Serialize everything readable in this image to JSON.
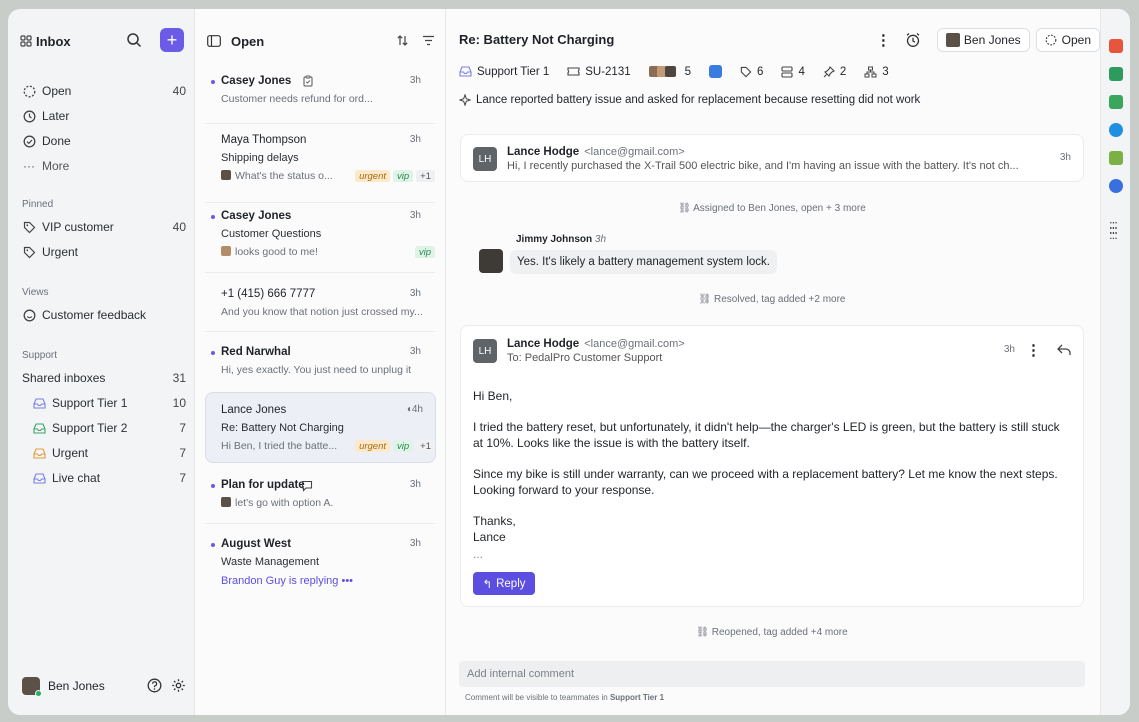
{
  "sidebar": {
    "title": "Inbox",
    "nav": [
      {
        "label": "Open",
        "count": "40"
      },
      {
        "label": "Later",
        "count": ""
      },
      {
        "label": "Done",
        "count": ""
      },
      {
        "label": "More",
        "count": ""
      }
    ],
    "pinned_label": "Pinned",
    "pinned": [
      {
        "label": "VIP customer",
        "count": "40"
      },
      {
        "label": "Urgent",
        "count": ""
      }
    ],
    "views_label": "Views",
    "views": [
      {
        "label": "Customer feedback"
      }
    ],
    "support_label": "Support",
    "shared_inboxes": {
      "label": "Shared inboxes",
      "count": "31"
    },
    "inboxes": [
      {
        "label": "Support Tier 1",
        "count": "10"
      },
      {
        "label": "Support Tier 2",
        "count": "7"
      },
      {
        "label": "Urgent",
        "count": "7"
      },
      {
        "label": "Live chat",
        "count": "7"
      }
    ],
    "user": "Ben Jones"
  },
  "list": {
    "title": "Open",
    "items": [
      {
        "name": "Casey Jones",
        "time": "3h",
        "subject": "",
        "preview": "Customer needs refund for ord..."
      },
      {
        "name": "Maya Thompson",
        "time": "3h",
        "subject": "Shipping delays",
        "preview": "What's the status o...",
        "tags": [
          "urgent",
          "vip",
          "+1"
        ]
      },
      {
        "name": "Casey Jones",
        "time": "3h",
        "subject": "Customer Questions",
        "preview": "looks good to me!",
        "tags": [
          "vip"
        ]
      },
      {
        "name": "+1 (415) 666 7777",
        "time": "3h",
        "subject": "",
        "preview": "And you know that notion just crossed my..."
      },
      {
        "name": "Red Narwhal",
        "time": "3h",
        "subject": "",
        "preview": "Hi, yes exactly. You just need to unplug it"
      },
      {
        "name": "Lance Jones",
        "time": "4h",
        "subject": "Re: Battery Not Charging",
        "preview": "Hi Ben, I tried the batte...",
        "tags": [
          "urgent",
          "vip",
          "+1"
        ]
      },
      {
        "name": "Plan for update",
        "time": "3h",
        "subject": "",
        "preview": "let's go with option A."
      },
      {
        "name": "August West",
        "time": "3h",
        "subject": "Waste Management",
        "preview": "Brandon Guy is replying"
      }
    ]
  },
  "conversation": {
    "title": "Re: Battery Not Charging",
    "assignee": "Ben Jones",
    "status": "Open",
    "meta": {
      "inbox": "Support Tier 1",
      "ticket": "SU-2131",
      "people": "5",
      "tags": "6",
      "stack": "4",
      "pins": "2",
      "links": "3"
    },
    "summary": "Lance reported battery issue and asked for replacement because resetting did not work",
    "msg1": {
      "initials": "LH",
      "name": "Lance Hodge",
      "email": "<lance@gmail.com>",
      "time": "3h",
      "preview": "Hi, I recently purchased the X-Trail 500 electric bike, and I'm having an issue with the battery. It's not ch..."
    },
    "event1": "Assigned to Ben Jones, open + 3 more",
    "chat": {
      "name": "Jimmy Johnson",
      "time": "3h",
      "text": "Yes. It's likely a battery management system lock."
    },
    "event2": "Resolved, tag added +2 more",
    "msg2": {
      "initials": "LH",
      "name": "Lance Hodge",
      "email": "<lance@gmail.com>",
      "to": "To: PedalPro Customer Support",
      "time": "3h",
      "greeting": "Hi Ben,",
      "p1": "I tried the battery reset, but unfortunately, it didn't help—the charger's LED is green, but the battery is still stuck at 10%. Looks like the issue is with the battery itself.",
      "p2": "Since my bike is still under warranty, can we proceed with a replacement battery? Let me know the next steps. Looking forward to your response.",
      "signoff": "Thanks,",
      "signname": "Lance",
      "ellipsis": "...",
      "reply": "Reply"
    },
    "event3": "Reopened, tag added +4 more",
    "comment_placeholder": "Add internal comment",
    "comment_hint": "Comment will be visible to teammates in",
    "comment_hint_inbox": "Support Tier 1"
  },
  "colors": {
    "accent": "#6b5ce7",
    "urgent": "#fde9c9",
    "vip": "#dff3e6"
  }
}
